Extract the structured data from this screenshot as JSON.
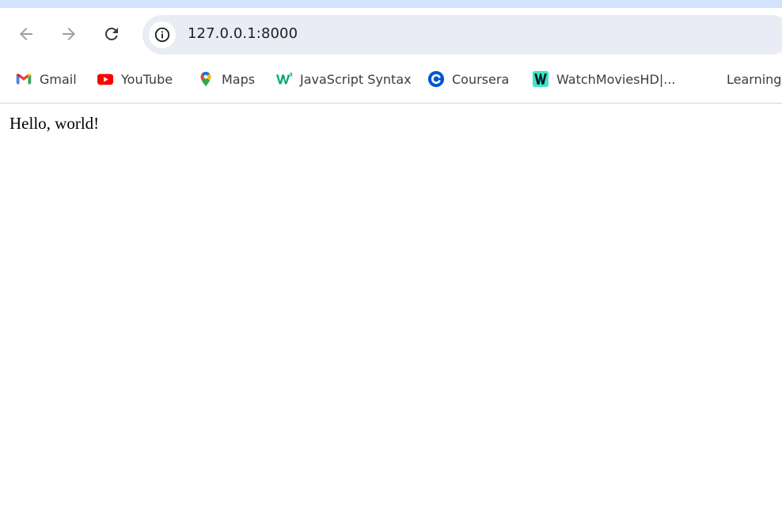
{
  "browser": {
    "url": "127.0.0.1:8000",
    "bookmarks": [
      {
        "label": "Gmail",
        "icon": "gmail-icon"
      },
      {
        "label": "YouTube",
        "icon": "youtube-icon"
      },
      {
        "label": "Maps",
        "icon": "maps-icon"
      },
      {
        "label": "JavaScript Syntax",
        "icon": "w3schools-icon"
      },
      {
        "label": "Coursera",
        "icon": "coursera-icon"
      },
      {
        "label": "WatchMoviesHD|...",
        "icon": "watchmovies-icon"
      },
      {
        "label": "Learning",
        "icon": ""
      }
    ]
  },
  "page": {
    "text": "Hello, world!"
  },
  "colors": {
    "tabstrip": "#d3e3fd",
    "omnibox": "#e9ecf5"
  }
}
